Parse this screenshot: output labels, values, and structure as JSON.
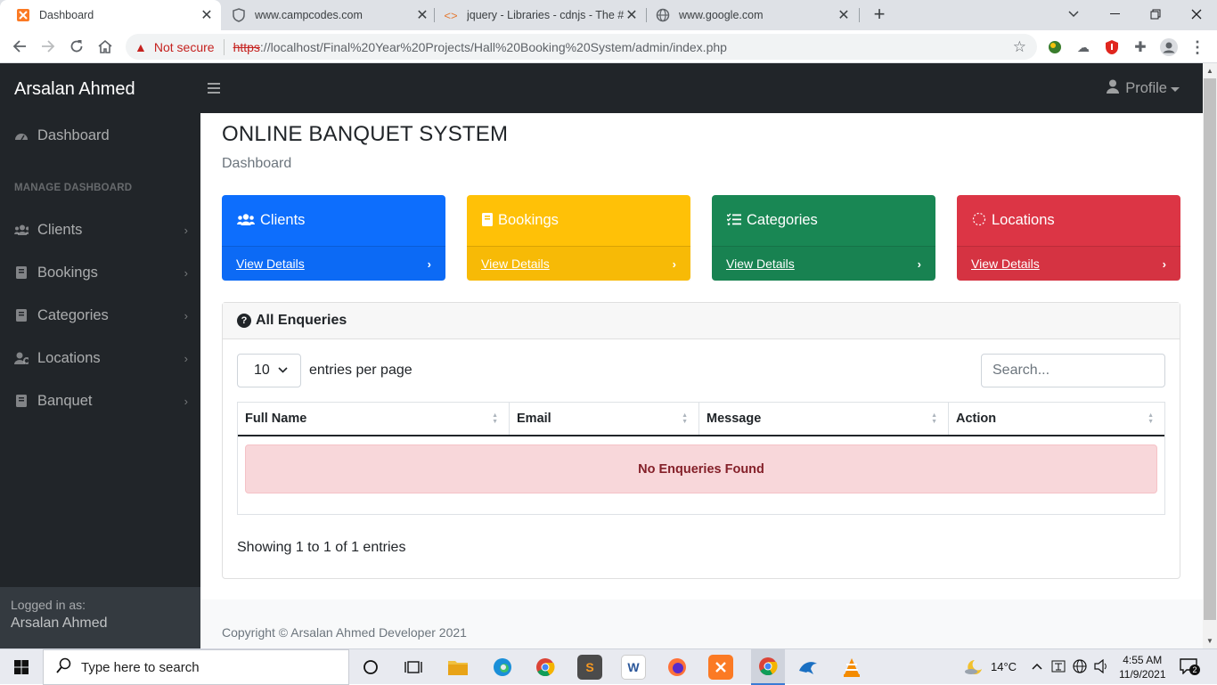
{
  "browser": {
    "tabs": [
      {
        "title": "Dashboard",
        "active": true
      },
      {
        "title": "www.campcodes.com",
        "active": false
      },
      {
        "title": "jquery - Libraries - cdnjs - The #1",
        "active": false
      },
      {
        "title": "www.google.com",
        "active": false
      }
    ],
    "new_tab": "+",
    "not_secure": "Not secure",
    "url_scheme": "https",
    "url_rest": "://localhost/Final%20Year%20Projects/Hall%20Booking%20System/admin/index.php"
  },
  "sidebar": {
    "brand": "Arsalan Ahmed",
    "dashboard_label": "Dashboard",
    "section_heading": "MANAGE DASHBOARD",
    "items": [
      {
        "label": "Clients",
        "icon": "users-icon"
      },
      {
        "label": "Bookings",
        "icon": "book-icon"
      },
      {
        "label": "Categories",
        "icon": "book-icon"
      },
      {
        "label": "Locations",
        "icon": "user-cog-icon"
      },
      {
        "label": "Banquet",
        "icon": "book-icon"
      }
    ],
    "footer_label": "Logged in as:",
    "footer_user": "Arsalan Ahmed"
  },
  "topnav": {
    "profile_label": "Profile"
  },
  "main": {
    "title": "ONLINE BANQUET SYSTEM",
    "breadcrumb": "Dashboard",
    "cards": [
      {
        "label": "Clients",
        "link": "View Details",
        "color": "#0d6efd"
      },
      {
        "label": "Bookings",
        "link": "View Details",
        "color": "#ffc107"
      },
      {
        "label": "Categories",
        "link": "View Details",
        "color": "#198754"
      },
      {
        "label": "Locations",
        "link": "View Details",
        "color": "#dc3545"
      }
    ],
    "enquiries": {
      "title": "All Enqueries",
      "per_page_value": "10",
      "per_page_label": "entries per page",
      "search_placeholder": "Search...",
      "columns": [
        "Full Name",
        "Email",
        "Message",
        "Action"
      ],
      "empty_message": "No Enqueries Found",
      "info": "Showing 1 to 1 of 1 entries"
    }
  },
  "footer": {
    "copyright": "Copyright © Arsalan Ahmed Developer 2021"
  },
  "taskbar": {
    "search_placeholder": "Type here to search",
    "temperature": "14°C",
    "time": "4:55 AM",
    "date": "11/9/2021",
    "notifications": "2"
  }
}
